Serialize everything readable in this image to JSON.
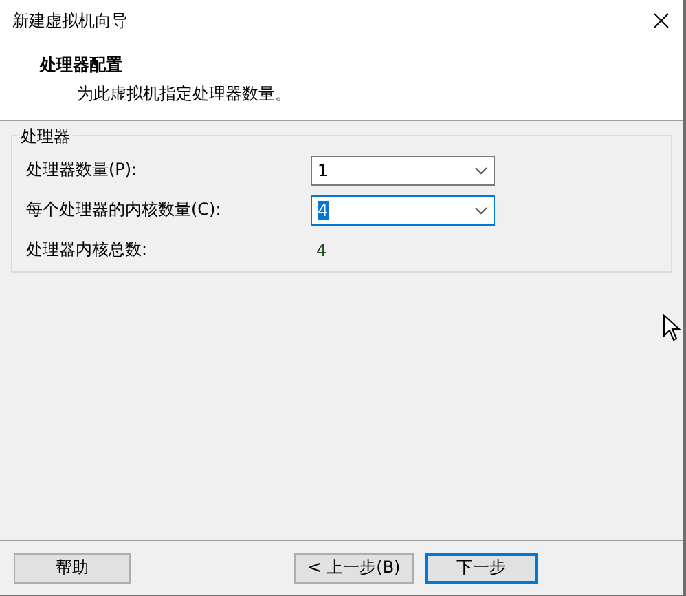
{
  "window": {
    "title": "新建虚拟机向导"
  },
  "header": {
    "title": "处理器配置",
    "subtitle": "为此虚拟机指定处理器数量。"
  },
  "group": {
    "title": "处理器",
    "fields": [
      {
        "kind": "dropdown",
        "label": "处理器数量(P):",
        "value": "1",
        "focused": false
      },
      {
        "kind": "dropdown",
        "label": "每个处理器的内核数量(C):",
        "value": "4",
        "focused": true
      },
      {
        "kind": "readout",
        "label": "处理器内核总数:",
        "value": "4"
      }
    ]
  },
  "buttons": [
    {
      "label": "帮助",
      "default": false
    },
    {
      "label": "< 上一步(B)",
      "default": false
    },
    {
      "label": "下一步",
      "default": true
    }
  ]
}
